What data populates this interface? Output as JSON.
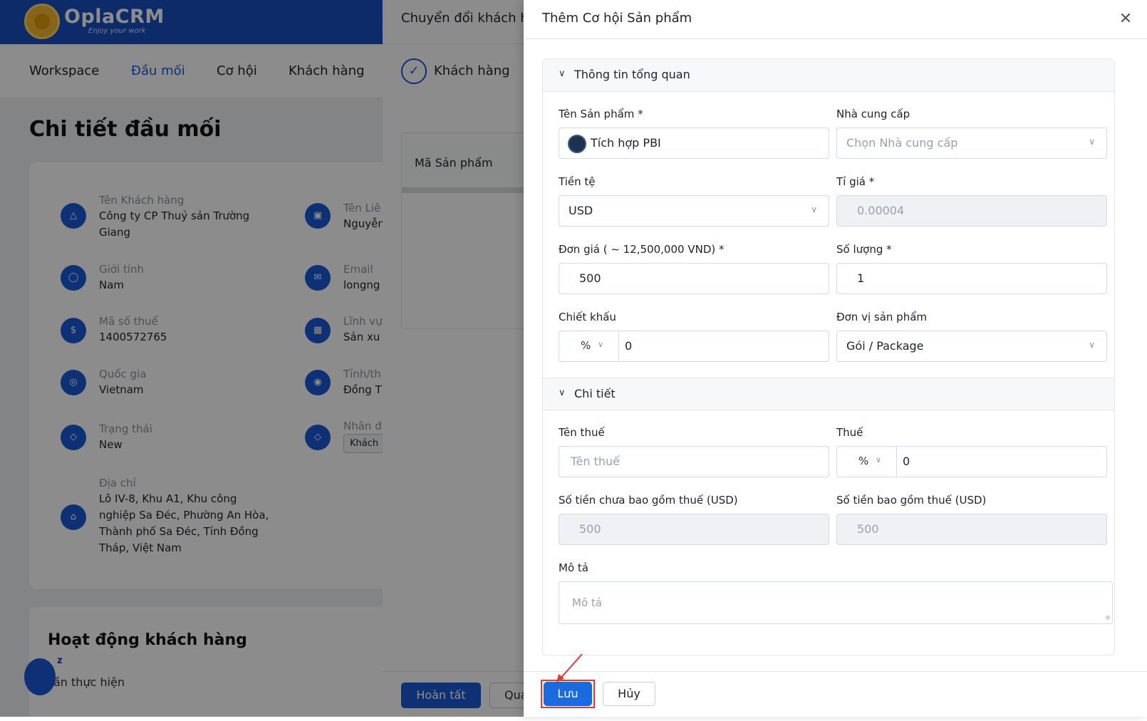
{
  "app": {
    "logo_text": "OplaCRM",
    "logo_sub": "Enjoy your work",
    "nav": [
      "Workspace",
      "Đầu mối",
      "Cơ hội",
      "Khách hàng"
    ],
    "page_title": "Chi tiết đầu mối",
    "info": {
      "customer_name_label": "Tên Khách hàng",
      "customer_name": "Công ty CP Thuỷ sản Trường Giang",
      "contact_label": "Tên Liê",
      "contact_value": "Nguyễn",
      "gender_label": "Giới tính",
      "gender": "Nam",
      "email_label": "Email",
      "email_value": "longng",
      "tax_label": "Mã số thuế",
      "tax": "1400572765",
      "industry_label": "Lĩnh vự",
      "industry_value": "Sản xu",
      "country_label": "Quốc gia",
      "country": "Vietnam",
      "province_label": "Tỉnh/th",
      "province_value": "Đồng T",
      "status_label": "Trạng thái",
      "status": "New",
      "tag_label": "Nhãn đ",
      "tag_value": "Khách",
      "address_label": "Địa chỉ",
      "address": "Lô IV-8, Khu A1, Khu công nghiệp Sa Đéc, Phường An Hòa, Thành phố Sa Đéc, Tỉnh Đồng Tháp, Việt Nam"
    },
    "activity_title": "Hoạt động khách hàng",
    "activity_sub": "ần thực hiện",
    "chat_badge": "z"
  },
  "convert_drawer": {
    "title": "Chuyển đổi khách h",
    "step_label": "Khách hàng",
    "table_header": "Mã Sản phẩm",
    "finish_button": "Hoàn tất",
    "other_button": "Qua"
  },
  "modal": {
    "title": "Thêm Cơ hội Sản phẩm",
    "section_overview": "Thông tin tổng quan",
    "section_detail": "Chi tiết",
    "product_name_label": "Tên Sản phẩm *",
    "product_name_value": "Tích hợp PBI",
    "supplier_label": "Nhà cung cấp",
    "supplier_placeholder": "Chọn Nhà cung cấp",
    "currency_label": "Tiền tệ",
    "currency_value": "USD",
    "rate_label": "Tỉ giá *",
    "rate_value": "0.00004",
    "unit_price_label": "Đơn giá ( ~ 12,500,000 VND) *",
    "unit_price_value": "500",
    "quantity_label": "Số lượng *",
    "quantity_value": "1",
    "discount_label": "Chiết khấu",
    "discount_type": "%",
    "discount_value": "0",
    "unit_label": "Đơn vị sản phẩm",
    "unit_value": "Gói / Package",
    "tax_name_label": "Tên thuế",
    "tax_name_placeholder": "Tên thuế",
    "tax_label": "Thuế",
    "tax_type": "%",
    "tax_value": "0",
    "amount_excl_label": "Số tiền chưa bao gồm thuế (USD)",
    "amount_excl_value": "500",
    "amount_incl_label": "Số tiền bao gồm thuế (USD)",
    "amount_incl_value": "500",
    "desc_label": "Mô tả",
    "desc_placeholder": "Mô tả",
    "save_button": "Lưu",
    "cancel_button": "Hủy"
  },
  "colors": {
    "primary": "#1a5ad6",
    "save": "#1a6be0",
    "highlight": "#e53935",
    "topbar": "#1a4fbf"
  },
  "icons": [
    "close-icon",
    "chevron-down-icon",
    "check-icon",
    "building-icon",
    "gender-icon",
    "tax-icon",
    "globe-icon",
    "tag-icon",
    "home-icon",
    "email-icon",
    "id-card-icon",
    "location-icon"
  ]
}
